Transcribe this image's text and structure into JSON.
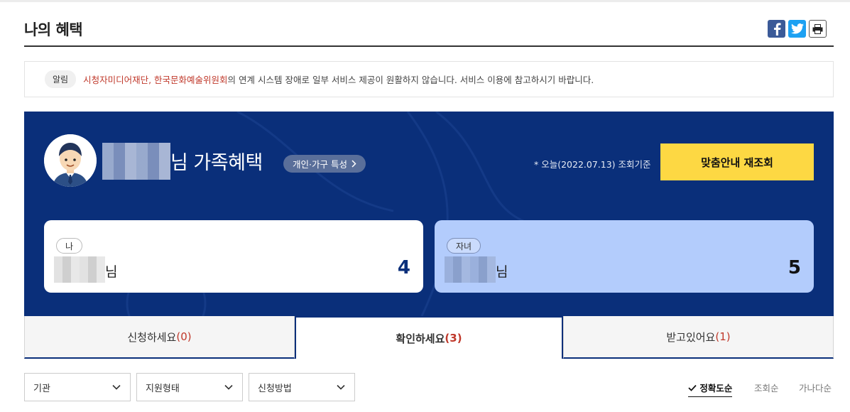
{
  "page": {
    "title": "나의 혜택"
  },
  "share": {
    "facebook_icon": "facebook-icon",
    "twitter_icon": "twitter-icon",
    "print_icon": "print-icon"
  },
  "notice": {
    "badge": "알림",
    "highlight": "시청자미디어재단, 한국문화예술위원회",
    "text": "의 연계 시스템 장애로 일부 서비스 제공이 원활하지 않습니다. 서비스 이용에 참고하시기 바랍니다."
  },
  "hero": {
    "title_suffix": "님 가족혜택",
    "trait_button": "개인·가구 특성",
    "as_of": "* 오늘(2022.07.13) 조회기준",
    "recheck_button": "맞춤안내 재조회",
    "colors": {
      "bg": "#0a2f7a",
      "button": "#fdd843"
    }
  },
  "members": [
    {
      "role": "나",
      "name_suffix": "님",
      "count": "4"
    },
    {
      "role": "자녀",
      "name_suffix": "님",
      "count": "5"
    }
  ],
  "tabs": [
    {
      "label": "신청하세요",
      "count": "(0)"
    },
    {
      "label": "확인하세요",
      "count": "(3)"
    },
    {
      "label": "받고있어요",
      "count": "(1)"
    }
  ],
  "filters": [
    {
      "label": "기관"
    },
    {
      "label": "지원형태"
    },
    {
      "label": "신청방법"
    }
  ],
  "sort": [
    {
      "label": "정확도순",
      "active": true
    },
    {
      "label": "조회순"
    },
    {
      "label": "가나다순"
    }
  ]
}
